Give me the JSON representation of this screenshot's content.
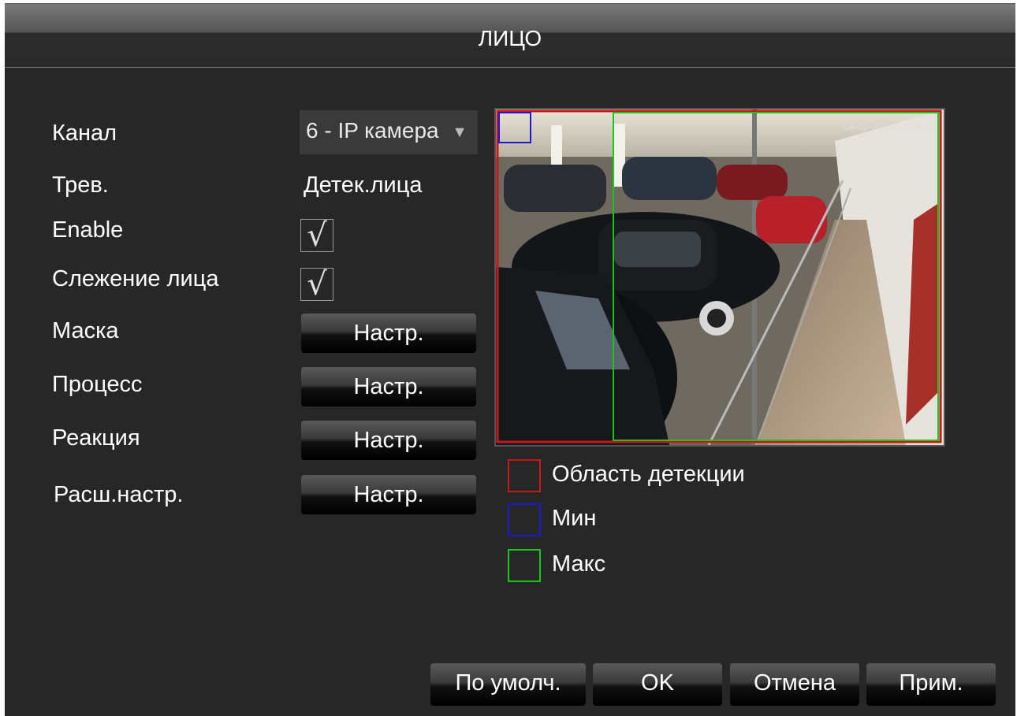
{
  "dialog": {
    "title": "ЛИЦО"
  },
  "fields": {
    "channel_label": "Канал",
    "channel_value": "6 - IP камера",
    "alarm_label": "Трев.",
    "alarm_value": "Детек.лица",
    "enable_label": "Enable",
    "enable_checked": true,
    "tracking_label": "Слежение лица",
    "tracking_checked": true,
    "mask_label": "Маска",
    "process_label": "Процесс",
    "reaction_label": "Реакция",
    "advanced_label": "Расш.настр.",
    "setup_label": "Настр.",
    "check_glyph": "√"
  },
  "preview": {
    "timestamp": "04-02-2016 13:07:43"
  },
  "legend": [
    {
      "label": "Область детекции",
      "color": "#c41a1a"
    },
    {
      "label": "Мин",
      "color": "#1a1ad0"
    },
    {
      "label": "Макс",
      "color": "#18c818"
    }
  ],
  "footer": {
    "default_label": "По умолч.",
    "ok_label": "OK",
    "cancel_label": "Отмена",
    "apply_label": "Прим."
  }
}
